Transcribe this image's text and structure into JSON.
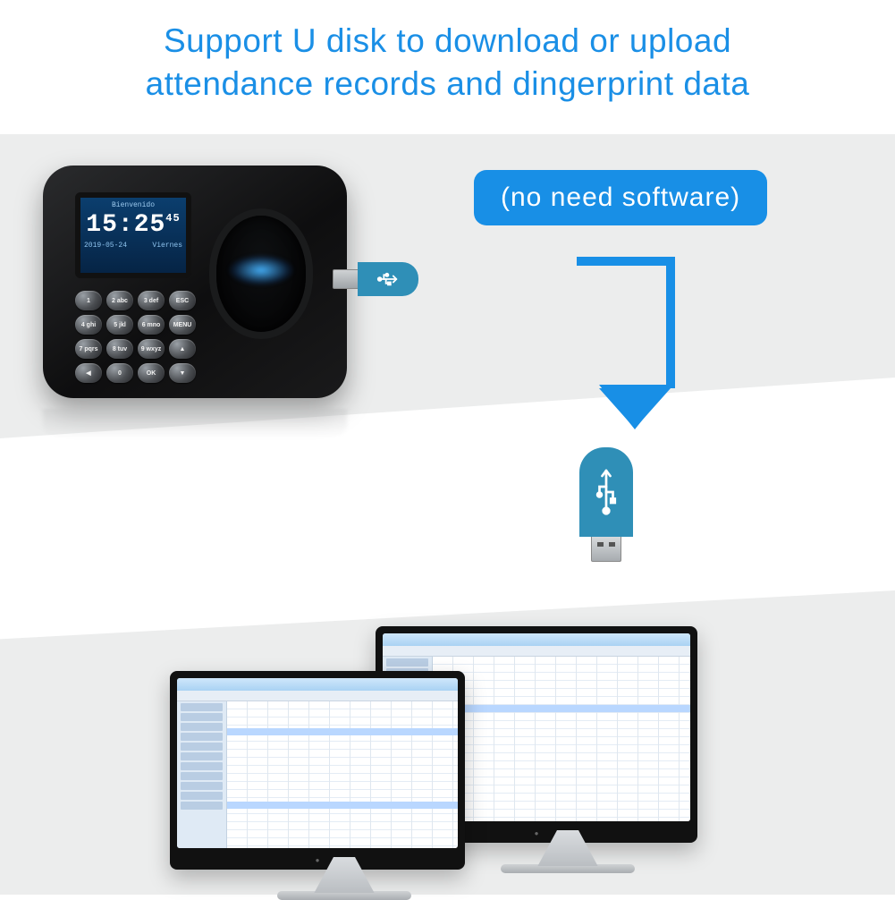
{
  "headline_line1": "Support U disk to download or upload",
  "headline_line2": "attendance records and dingerprint data",
  "badge_text": "(no need  software)",
  "device": {
    "screen_welcome": "Bienvenido",
    "screen_time_main": "15:25",
    "screen_time_sec": "45",
    "screen_date": "2019-05-24",
    "screen_day": "Viernes",
    "keys": [
      "1",
      "2 abc",
      "3 def",
      "ESC",
      "4 ghi",
      "5 jkl",
      "6 mno",
      "MENU",
      "7 pqrs",
      "8 tuv",
      "9 wxyz",
      "▲",
      "◀",
      "0",
      "OK",
      "▼"
    ]
  },
  "colors": {
    "brand_blue": "#188fe6",
    "usb_blue": "#2f8fb7"
  }
}
